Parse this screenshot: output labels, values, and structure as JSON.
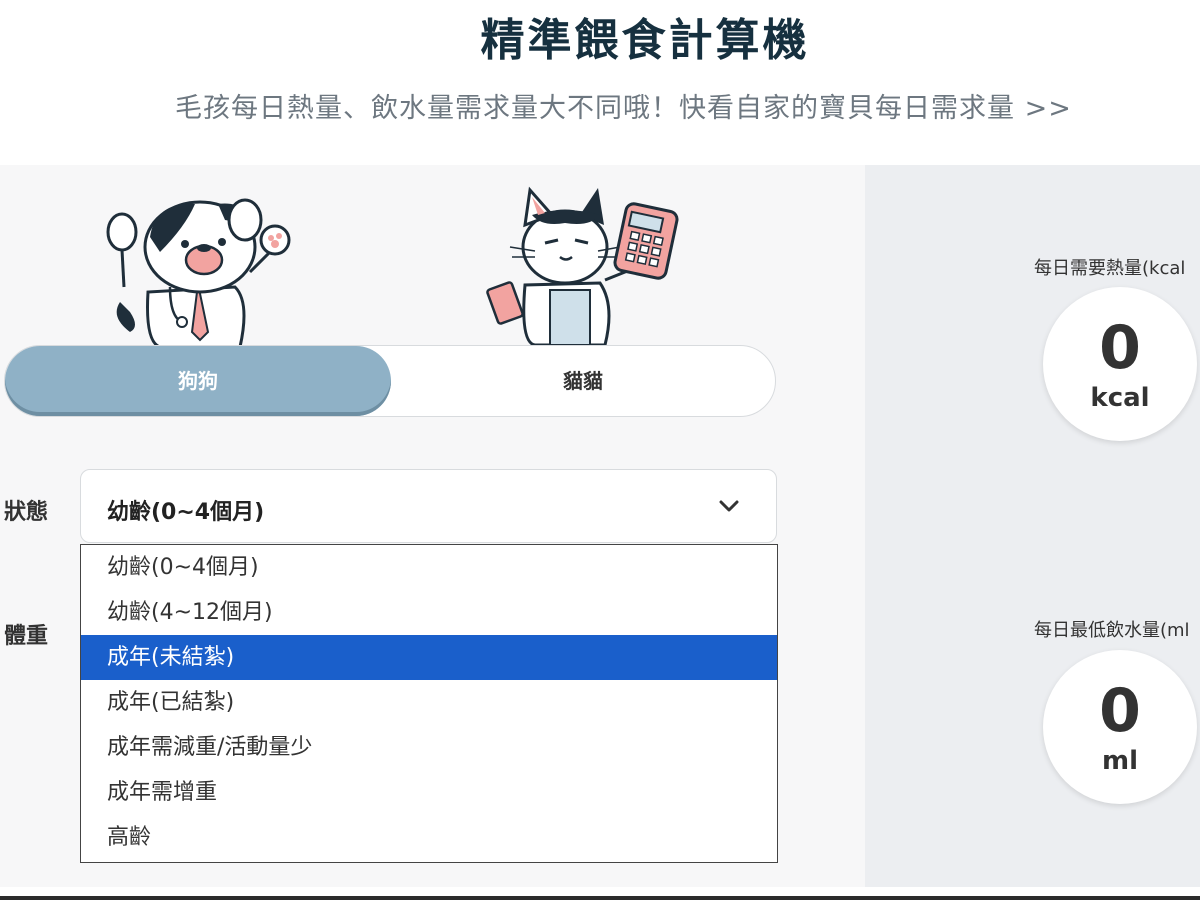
{
  "header": {
    "title": "精準餵食計算機",
    "subtitle": "毛孩每日熱量、飲水量需求量大不同哦！快看自家的寶貝每日需求量 >>"
  },
  "pet_toggle": {
    "options": [
      "狗狗",
      "貓貓"
    ],
    "selected": "狗狗"
  },
  "form": {
    "state_label": "狀態",
    "weight_label": "體重",
    "state_select": {
      "value": "幼齡(0~4個月)",
      "options": [
        "幼齡(0~4個月)",
        "幼齡(4~12個月)",
        "成年(未結紮)",
        "成年(已結紮)",
        "成年需減重/活動量少",
        "成年需增重",
        "高齡"
      ],
      "highlighted": "成年(未結紮)"
    }
  },
  "results": {
    "calories": {
      "label": "每日需要熱量(kcal",
      "value": "0",
      "unit": "kcal"
    },
    "water": {
      "label": "每日最低飲水量(ml",
      "value": "0",
      "unit": "ml"
    }
  },
  "colors": {
    "title": "#16303f",
    "toggle_active": "#8fb1c6",
    "highlight": "#1a5fcb"
  },
  "icons": {
    "select_arrow": "chevron-down-icon",
    "dog_mascot": "dog-doctor-illustration",
    "cat_mascot": "cat-calculator-illustration"
  }
}
